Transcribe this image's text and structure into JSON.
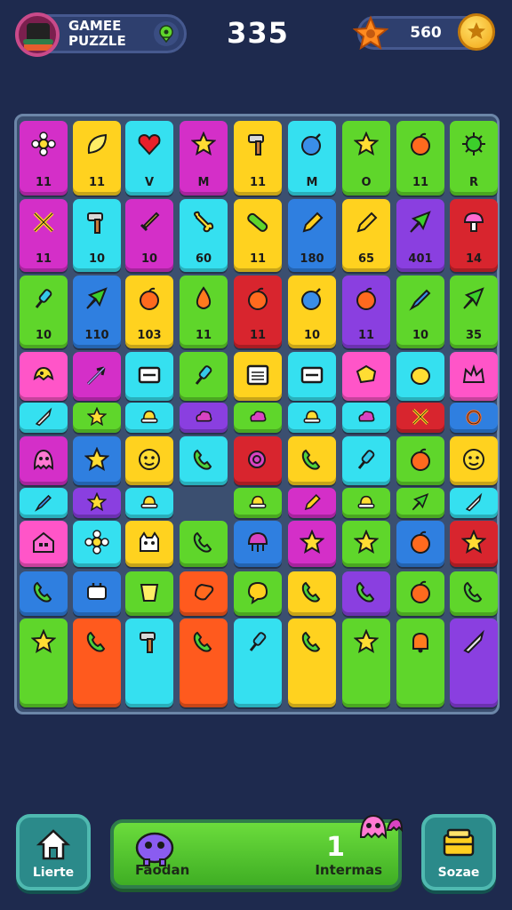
{
  "header": {
    "title_line1": "GAMEE",
    "title_line2": "PUZZLE",
    "score": "335",
    "coins": "560"
  },
  "colors": {
    "background": "#1e2a4e",
    "board": "#3b4f70",
    "magenta": "#d42fc8",
    "yellow": "#ffd21f",
    "cyan": "#35e0f0",
    "green": "#5fd62b",
    "blue": "#2f7fe0",
    "red": "#d8252e",
    "purple": "#8a3fe0",
    "pink": "#ff55c8",
    "orange": "#ff5a1e"
  },
  "board": {
    "tiles": [
      {
        "color": "magenta",
        "icon": "flower-icon",
        "label": "11"
      },
      {
        "color": "yellow",
        "icon": "leaf-icon",
        "label": "11"
      },
      {
        "color": "cyan",
        "icon": "heart-icon",
        "label": "V"
      },
      {
        "color": "magenta",
        "icon": "star-icon",
        "label": "M"
      },
      {
        "color": "yellow",
        "icon": "hammer-icon",
        "label": "11"
      },
      {
        "color": "cyan",
        "icon": "bomb-icon",
        "label": "M"
      },
      {
        "color": "green",
        "icon": "star-icon",
        "label": "O"
      },
      {
        "color": "green",
        "icon": "apple-icon",
        "label": "11"
      },
      {
        "color": "green",
        "icon": "sun-icon",
        "label": "R"
      },
      {
        "color": "magenta",
        "icon": "crossed-swords-icon",
        "label": "11"
      },
      {
        "color": "cyan",
        "icon": "hammer-icon",
        "label": "10"
      },
      {
        "color": "magenta",
        "icon": "sword-icon",
        "label": "10"
      },
      {
        "color": "cyan",
        "icon": "bone-icon",
        "label": "60"
      },
      {
        "color": "yellow",
        "icon": "bandage-icon",
        "label": "11"
      },
      {
        "color": "blue",
        "icon": "pencil-icon",
        "label": "180"
      },
      {
        "color": "yellow",
        "icon": "pencil-icon",
        "label": "65"
      },
      {
        "color": "purple",
        "icon": "plane-icon",
        "label": "401"
      },
      {
        "color": "red",
        "icon": "mushroom-icon",
        "label": "14"
      },
      {
        "color": "green",
        "icon": "pin-icon",
        "label": "10"
      },
      {
        "color": "blue",
        "icon": "plane-icon",
        "label": "110"
      },
      {
        "color": "yellow",
        "icon": "apple-icon",
        "label": "103"
      },
      {
        "color": "green",
        "icon": "drop-icon",
        "label": "11"
      },
      {
        "color": "red",
        "icon": "apple-icon",
        "label": "11"
      },
      {
        "color": "yellow",
        "icon": "bomb-icon",
        "label": "10"
      },
      {
        "color": "purple",
        "icon": "apple-icon",
        "label": "11"
      },
      {
        "color": "green",
        "icon": "pen-icon",
        "label": "10"
      },
      {
        "color": "green",
        "icon": "plane-icon",
        "label": "35"
      },
      {
        "color": "pink",
        "icon": "fish-icon",
        "label": ""
      },
      {
        "color": "magenta",
        "icon": "arrow-icon",
        "label": ""
      },
      {
        "color": "cyan",
        "icon": "window-icon",
        "label": ""
      },
      {
        "color": "green",
        "icon": "pin-icon",
        "label": ""
      },
      {
        "color": "yellow",
        "icon": "calendar-icon",
        "label": ""
      },
      {
        "color": "cyan",
        "icon": "window-icon",
        "label": ""
      },
      {
        "color": "pink",
        "icon": "cheese-icon",
        "label": ""
      },
      {
        "color": "cyan",
        "icon": "lemon-icon",
        "label": ""
      },
      {
        "color": "pink",
        "icon": "crown-icon",
        "label": ""
      },
      {
        "color": "cyan",
        "icon": "knife-icon",
        "label": ""
      },
      {
        "color": "green",
        "icon": "star-icon",
        "label": ""
      },
      {
        "color": "cyan",
        "icon": "hat-icon",
        "label": ""
      },
      {
        "color": "purple",
        "icon": "cloud-icon",
        "label": ""
      },
      {
        "color": "green",
        "icon": "cloud-icon",
        "label": ""
      },
      {
        "color": "cyan",
        "icon": "hat-icon",
        "label": ""
      },
      {
        "color": "cyan",
        "icon": "cloud-icon",
        "label": ""
      },
      {
        "color": "red",
        "icon": "crossed-swords-icon",
        "label": ""
      },
      {
        "color": "blue",
        "icon": "ring-icon",
        "label": ""
      },
      {
        "color": "magenta",
        "icon": "ghost-icon",
        "label": ""
      },
      {
        "color": "blue",
        "icon": "star-icon",
        "label": ""
      },
      {
        "color": "yellow",
        "icon": "face-icon",
        "label": ""
      },
      {
        "color": "cyan",
        "icon": "phone-icon",
        "label": ""
      },
      {
        "color": "red",
        "icon": "snail-icon",
        "label": ""
      },
      {
        "color": "yellow",
        "icon": "phone-icon",
        "label": ""
      },
      {
        "color": "cyan",
        "icon": "pin-icon",
        "label": ""
      },
      {
        "color": "green",
        "icon": "apple-icon",
        "label": ""
      },
      {
        "color": "yellow",
        "icon": "face-icon",
        "label": ""
      },
      {
        "color": "cyan",
        "icon": "pen-icon",
        "label": ""
      },
      {
        "color": "purple",
        "icon": "star-icon",
        "label": ""
      },
      {
        "color": "cyan",
        "icon": "hat-icon",
        "label": ""
      },
      {
        "color": "green",
        "icon": "hat-icon",
        "label": ""
      },
      {
        "color": "magenta",
        "icon": "pencil-icon",
        "label": ""
      },
      {
        "color": "green",
        "icon": "hat-icon",
        "label": ""
      },
      {
        "color": "green",
        "icon": "plane-icon",
        "label": ""
      },
      {
        "color": "cyan",
        "icon": "knife-icon",
        "label": ""
      },
      {
        "color": "pink",
        "icon": "house-icon",
        "label": ""
      },
      {
        "color": "cyan",
        "icon": "flower-icon",
        "label": ""
      },
      {
        "color": "yellow",
        "icon": "cat-icon",
        "label": ""
      },
      {
        "color": "green",
        "icon": "phone-icon",
        "label": ""
      },
      {
        "color": "blue",
        "icon": "jellyfish-icon",
        "label": ""
      },
      {
        "color": "magenta",
        "icon": "star-icon",
        "label": ""
      },
      {
        "color": "green",
        "icon": "star-icon",
        "label": ""
      },
      {
        "color": "blue",
        "icon": "apple-icon",
        "label": ""
      },
      {
        "color": "red",
        "icon": "star-icon",
        "label": ""
      },
      {
        "color": "blue",
        "icon": "phone-icon",
        "label": ""
      },
      {
        "color": "blue",
        "icon": "plug-icon",
        "label": ""
      },
      {
        "color": "green",
        "icon": "cup-icon",
        "label": ""
      },
      {
        "color": "orange",
        "icon": "hand-icon",
        "label": ""
      },
      {
        "color": "green",
        "icon": "bubble-icon",
        "label": ""
      },
      {
        "color": "yellow",
        "icon": "phone-icon",
        "label": ""
      },
      {
        "color": "purple",
        "icon": "phone-icon",
        "label": ""
      },
      {
        "color": "green",
        "icon": "apple-icon",
        "label": ""
      },
      {
        "color": "green",
        "icon": "phone-icon",
        "label": ""
      },
      {
        "color": "green",
        "icon": "star-icon",
        "label": ""
      },
      {
        "color": "orange",
        "icon": "phone-icon",
        "label": ""
      },
      {
        "color": "cyan",
        "icon": "hammer-icon",
        "label": ""
      },
      {
        "color": "orange",
        "icon": "phone-icon",
        "label": ""
      },
      {
        "color": "cyan",
        "icon": "pin-icon",
        "label": ""
      },
      {
        "color": "yellow",
        "icon": "phone-icon",
        "label": ""
      },
      {
        "color": "green",
        "icon": "star-icon",
        "label": ""
      },
      {
        "color": "green",
        "icon": "bell-icon",
        "label": ""
      },
      {
        "color": "purple",
        "icon": "knife-icon",
        "label": ""
      }
    ]
  },
  "footer": {
    "home_label": "Lierte",
    "center_left_label": "Faodan",
    "center_count": "1",
    "center_right_label": "Intermas",
    "right_label": "Sozae"
  }
}
